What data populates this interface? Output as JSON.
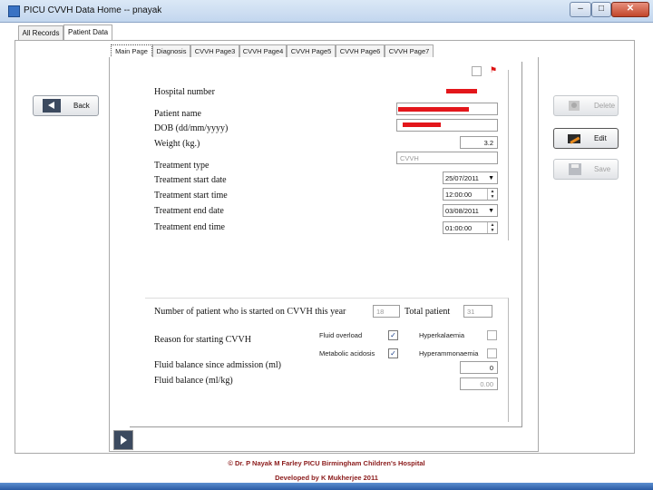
{
  "window": {
    "title": "PICU CVVH Data Home -- pnayak",
    "minimize": "–",
    "maximize": "□",
    "close": "✕"
  },
  "outer_tabs": [
    "All Records",
    "Patient Data"
  ],
  "inner_tabs": [
    "Main Page",
    "Diagnosis",
    "CVVH Page3",
    "CVVH Page4",
    "CVVH Page5",
    "CVVH Page6",
    "CVVH Page7"
  ],
  "form": {
    "hospital_number_label": "Hospital number",
    "patient_name_label": "Patient name",
    "dob_label": "DOB (dd/mm/yyyy)",
    "weight_label": "Weight (kg.)",
    "weight_value": "3.2",
    "treatment_type_label": "Treatment type",
    "treatment_type_value": "CVVH",
    "treatment_start_date_label": "Treatment start date",
    "treatment_start_date_value": "25/07/2011",
    "treatment_start_time_label": "Treatment start time",
    "treatment_start_time_value": "12:00:00",
    "treatment_end_date_label": "Treatment end date",
    "treatment_end_date_value": "03/08/2011",
    "treatment_end_time_label": "Treatment end time",
    "treatment_end_time_value": "01:00:00",
    "patients_started_label": "Number of patient who is started on CVVH this year",
    "patients_started_value": "18",
    "total_patient_label": "Total patient",
    "total_patient_value": "31",
    "reason_label": "Reason for starting CVVH",
    "reasons": {
      "fluid_overload": {
        "label": "Fluid overload",
        "checked": true
      },
      "metabolic_acidosis": {
        "label": "Metabolic acidosis",
        "checked": true
      },
      "hyperkalaemia": {
        "label": "Hyperkalaemia",
        "checked": false
      },
      "hyperammonaemia": {
        "label": "Hyperammonaemia",
        "checked": false
      }
    },
    "fluid_balance_label": "Fluid balance since admission (ml)",
    "fluid_balance_value": "0",
    "fluid_balance_ml_kg_label": "Fluid balance (ml/kg)",
    "fluid_balance_ml_kg_value": "0.00"
  },
  "buttons": {
    "back": "Back",
    "delete": "Delete",
    "edit": "Edit",
    "save": "Save"
  },
  "footer": {
    "line1": "© Dr. P Nayak  M Farley  PICU Birmingham Children's Hospital",
    "line2": "Developed by K Mukherjee 2011"
  },
  "colors": {
    "redaction": "#e3161b",
    "footer_text": "#8b1b1b",
    "check": "#1a3f8a"
  }
}
